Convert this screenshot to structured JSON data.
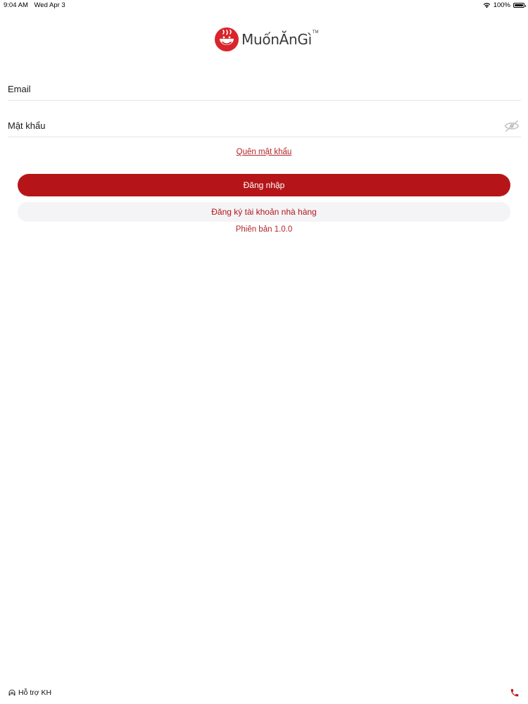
{
  "status_bar": {
    "time": "9:04 AM",
    "date": "Wed Apr 3",
    "battery": "100%",
    "icons": [
      "wifi-icon",
      "battery-icon"
    ]
  },
  "logo": {
    "text": "MuốnĂnGì",
    "tm": "TM",
    "icon": "bowl-logo-icon"
  },
  "form": {
    "email_placeholder": "Email",
    "email_value": "",
    "password_placeholder": "Mật khẩu",
    "password_value": "",
    "password_toggle_icon": "eye-hidden-icon",
    "forgot_label": "Quên mật khẩu"
  },
  "actions": {
    "login_label": "Đăng nhập",
    "register_label": "Đăng ký tài khoản nhà hàng"
  },
  "version_label": "Phiên bản 1.0.0",
  "footer": {
    "support_label": "Hỗ trợ KH",
    "support_icon": "headset-icon",
    "phone_icon": "phone-icon"
  },
  "colors": {
    "brand_red": "#b51518",
    "secondary_bg": "#f4f4f6",
    "link_red": "#b3262b"
  }
}
